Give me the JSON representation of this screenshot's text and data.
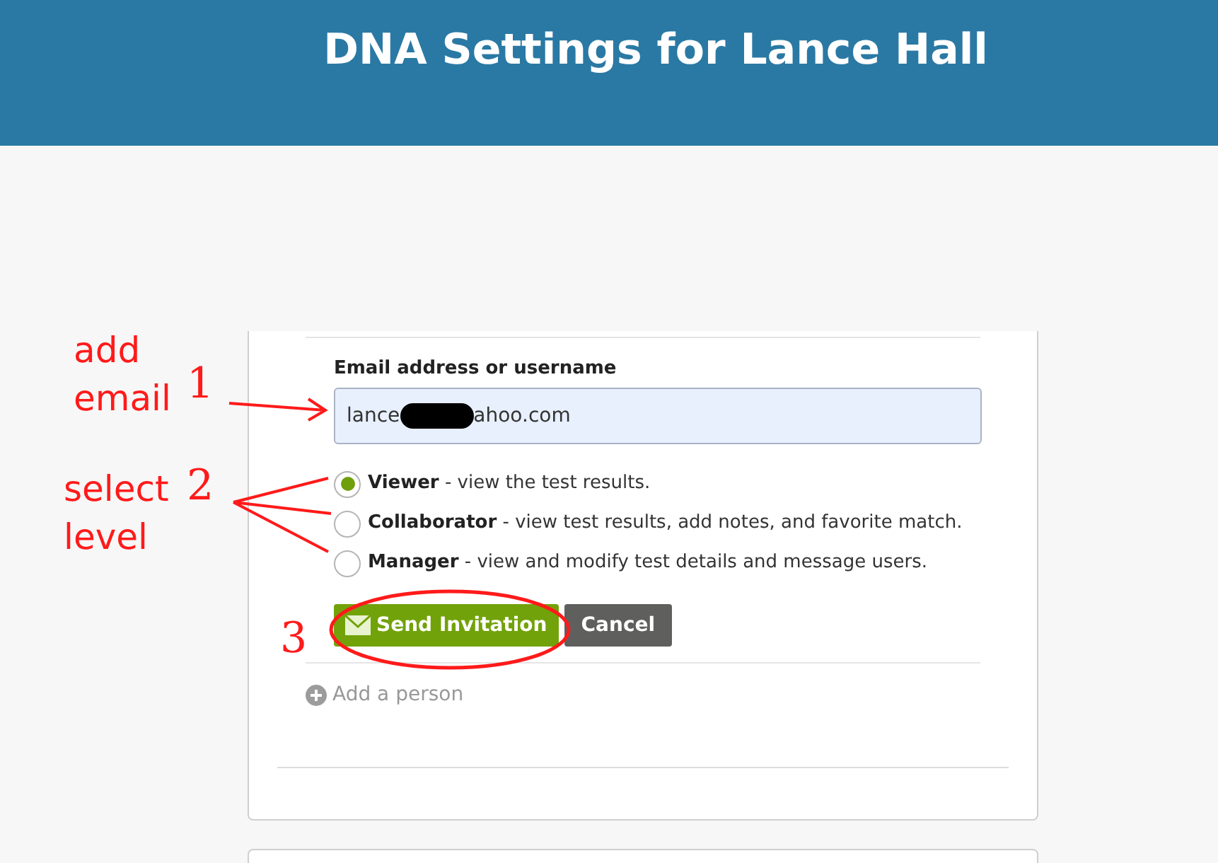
{
  "header": {
    "title": "DNA Settings for Lance Hall"
  },
  "form": {
    "label": "Email address or username",
    "email": {
      "value_start": "lance",
      "value_end": "ahoo.com",
      "redacted": true
    },
    "levels": [
      {
        "name": "Viewer",
        "description": " - view the test results.",
        "selected": true
      },
      {
        "name": "Collaborator",
        "description": " - view test results, add notes, and favorite match.",
        "selected": false
      },
      {
        "name": "Manager",
        "description": " - view and modify test details and message users.",
        "selected": false
      }
    ],
    "send_button": "Send Invitation",
    "cancel_button": "Cancel",
    "add_link": "Add a person"
  },
  "annotations": [
    {
      "text": "add",
      "kind": "word"
    },
    {
      "text": "email",
      "kind": "word"
    },
    {
      "text": "1",
      "kind": "digit"
    },
    {
      "text": "select",
      "kind": "word"
    },
    {
      "text": "level",
      "kind": "word"
    },
    {
      "text": "2",
      "kind": "digit"
    },
    {
      "text": "3",
      "kind": "digit"
    }
  ]
}
